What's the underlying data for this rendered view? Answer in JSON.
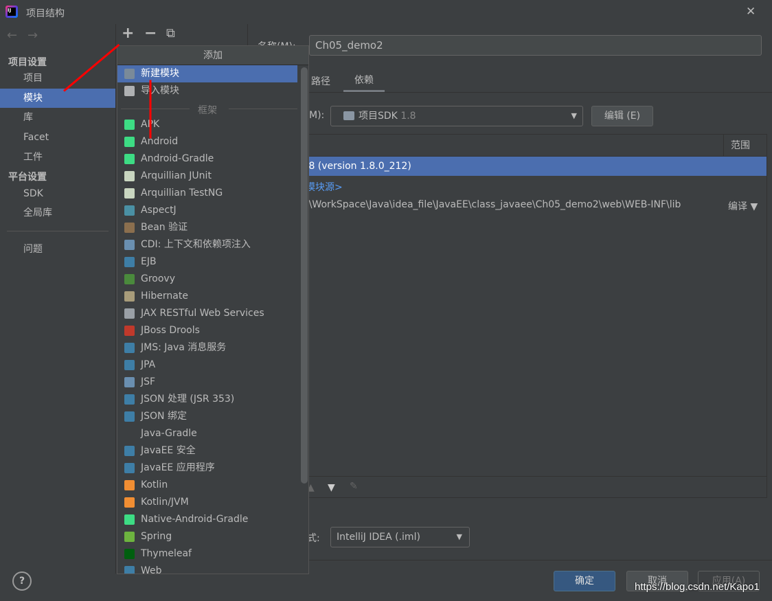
{
  "window": {
    "title": "项目结构",
    "close": "✕"
  },
  "nav": {
    "back": "←",
    "forward": "→"
  },
  "toolbar": {
    "add": "+",
    "remove": "−",
    "copy": "⧉"
  },
  "sidebar": {
    "project_settings": "项目设置",
    "items": [
      {
        "label": "项目"
      },
      {
        "label": "模块",
        "selected": true
      },
      {
        "label": "库"
      },
      {
        "label": "Facet"
      },
      {
        "label": "工件"
      }
    ],
    "platform_settings": "平台设置",
    "platform_items": [
      {
        "label": "SDK"
      },
      {
        "label": "全局库"
      }
    ],
    "problems": "问题"
  },
  "popup": {
    "title": "添加",
    "top_items": [
      {
        "label": "新建模块",
        "icon": "new-module-icon",
        "color": "#7a8a99"
      },
      {
        "label": "导入模块",
        "icon": "import-module-icon",
        "color": "#afb1b3"
      }
    ],
    "section": "框架",
    "items": [
      {
        "label": "APK",
        "color": "#3ddc84"
      },
      {
        "label": "Android",
        "color": "#3ddc84"
      },
      {
        "label": "Android-Gradle",
        "color": "#3ddc84"
      },
      {
        "label": "Arquillian JUnit",
        "color": "#c9d6c0"
      },
      {
        "label": "Arquillian TestNG",
        "color": "#c9d6c0"
      },
      {
        "label": "AspectJ",
        "color": "#4a90a4"
      },
      {
        "label": "Bean 验证",
        "color": "#8b6f4e"
      },
      {
        "label": "CDI: 上下文和依赖项注入",
        "color": "#6a8fb0"
      },
      {
        "label": "EJB",
        "color": "#3e7ea6"
      },
      {
        "label": "Groovy",
        "color": "#4a8a3c"
      },
      {
        "label": "Hibernate",
        "color": "#a89c7a"
      },
      {
        "label": "JAX RESTful Web Services",
        "color": "#9aa0a6"
      },
      {
        "label": "JBoss Drools",
        "color": "#c0392b"
      },
      {
        "label": "JMS: Java 消息服务",
        "color": "#3e7ea6"
      },
      {
        "label": "JPA",
        "color": "#3e7ea6"
      },
      {
        "label": "JSF",
        "color": "#6a8fb0"
      },
      {
        "label": "JSON 处理 (JSR 353)",
        "color": "#3e7ea6"
      },
      {
        "label": "JSON 绑定",
        "color": "#3e7ea6"
      },
      {
        "label": "Java-Gradle",
        "color": ""
      },
      {
        "label": "JavaEE 安全",
        "color": "#3e7ea6"
      },
      {
        "label": "JavaEE 应用程序",
        "color": "#3e7ea6"
      },
      {
        "label": "Kotlin",
        "color": "#f18e33"
      },
      {
        "label": "Kotlin/JVM",
        "color": "#f18e33"
      },
      {
        "label": "Native-Android-Gradle",
        "color": "#3ddc84"
      },
      {
        "label": "Spring",
        "color": "#6db33f"
      },
      {
        "label": "Thymeleaf",
        "color": "#005f0f"
      },
      {
        "label": "Web",
        "color": "#3e7ea6"
      }
    ]
  },
  "main": {
    "name_label": "名称(M):",
    "name_value": "Ch05_demo2",
    "tabs": [
      {
        "label": "路径"
      },
      {
        "label": "依赖",
        "active": true
      }
    ],
    "sdk_label": "M):",
    "sdk_value": "项目SDK",
    "sdk_version": "1.8",
    "edit_button": "编辑 (E)",
    "table_header_scope": "范围",
    "rows": [
      {
        "text": ".8 (version 1.8.0_212)",
        "scope": "",
        "selected": true
      },
      {
        "text": "模块源>",
        "scope": "",
        "link": true
      },
      {
        "text": ":\\WorkSpace\\Java\\idea_file\\JavaEE\\class_javaee\\Ch05_demo2\\web\\WEB-INF\\lib",
        "scope": "编译 ▼"
      }
    ],
    "format_label": "式:",
    "format_value": "IntelliJ IDEA (.iml)"
  },
  "footer": {
    "help": "?",
    "ok": "确定",
    "cancel": "取消",
    "apply": "应用(A)",
    "watermark": "https://blog.csdn.net/Kapo1"
  },
  "colors": {
    "background": "#3c3f41",
    "selection": "#4b6eaf",
    "annotation_arrow": "#ff0000",
    "link": "#589df6"
  }
}
